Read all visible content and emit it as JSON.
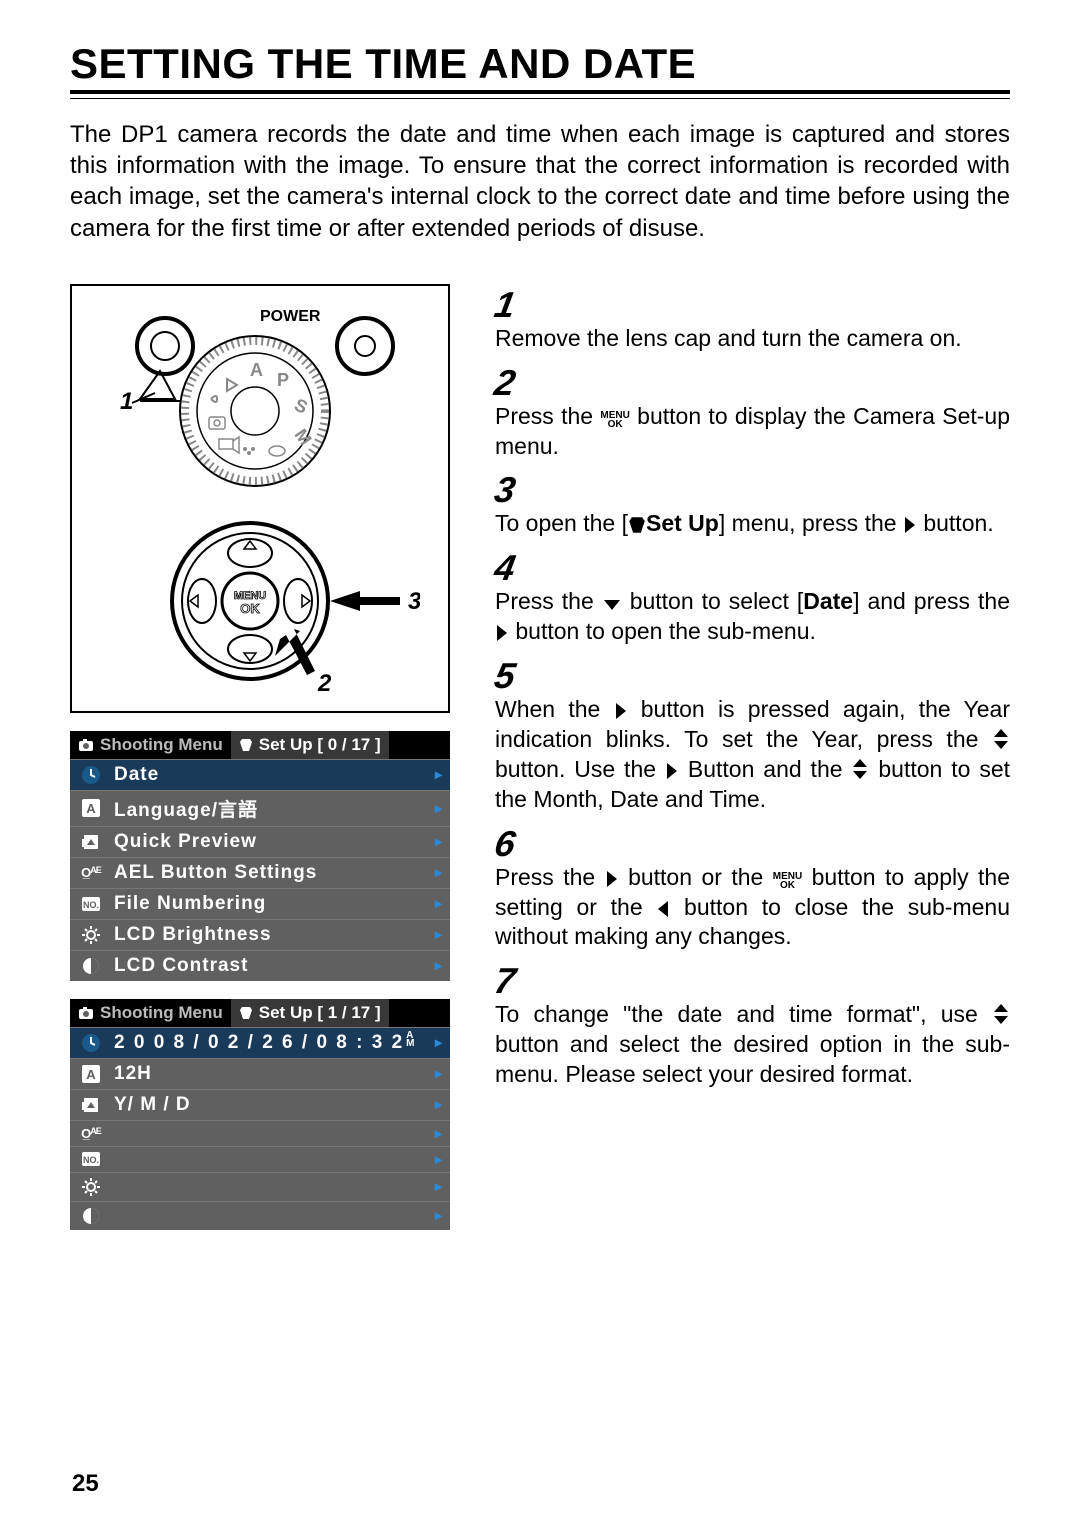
{
  "title": "SETTING THE TIME AND DATE",
  "intro": "The DP1 camera records the date and time when each image is captured and stores this information with the image. To ensure that the correct information is recorded with each image, set the camera's internal clock to the correct date and time before using the camera for the first time or after extended periods of disuse.",
  "diagram": {
    "power_label": "POWER",
    "center_button_top": "MENU",
    "center_button_bottom": "OK",
    "callout_1": "1",
    "callout_2": "2",
    "callout_3": "3"
  },
  "menu1": {
    "tab1": "Shooting Menu",
    "tab2": "Set Up [ 0 / 17 ]",
    "rows": [
      "Date",
      "Language/言語",
      "Quick Preview",
      "AEL Button Settings",
      "File Numbering",
      "LCD Brightness",
      "LCD Contrast"
    ]
  },
  "menu2": {
    "tab1": "Shooting Menu",
    "tab2": "Set Up [ 1 / 17 ]",
    "rows": [
      "2 0 0 8 / 0 2 / 2 6 / 0 8 : 3 2",
      "12H",
      "Y/ M / D",
      "",
      "",
      "",
      ""
    ],
    "am_suffix_top": "A",
    "am_suffix_bottom": "M"
  },
  "steps": {
    "n1": "1",
    "t1": "Remove the lens cap and turn the camera on.",
    "n2": "2",
    "t2a": "Press  the  ",
    "t2b": "  button  to  display  the Camera Set-up menu.",
    "n3": "3",
    "t3a": "To open the [",
    "t3b": "Set Up",
    "t3c": "] menu, press the ",
    "t3d": " button.",
    "n4": "4",
    "t4a": "Press  the  ",
    "t4b": "  button  to  select  [",
    "t4c": "Date",
    "t4d": "]  and press the ",
    "t4e": " button to open the sub-menu.",
    "n5": "5",
    "t5a": "When  the  ",
    "t5b": "  button  is  pressed  again,  the Year indication blinks. To set the Year, press the ",
    "t5c": " button. Use the ",
    "t5d": " Button and the ",
    "t5e": " button to set the Month, Date and Time.",
    "n6": "6",
    "t6a": "Press  the  ",
    "t6b": "  button  or  the  ",
    "t6c": "  button  to apply the setting or the ",
    "t6d": " button to close the sub-menu without making any changes.",
    "n7": "7",
    "t7a": "To change \"the date and time format\", use ",
    "t7b": " button and select the desired option in the sub-menu. Please select your desired format."
  },
  "page_number": "25"
}
